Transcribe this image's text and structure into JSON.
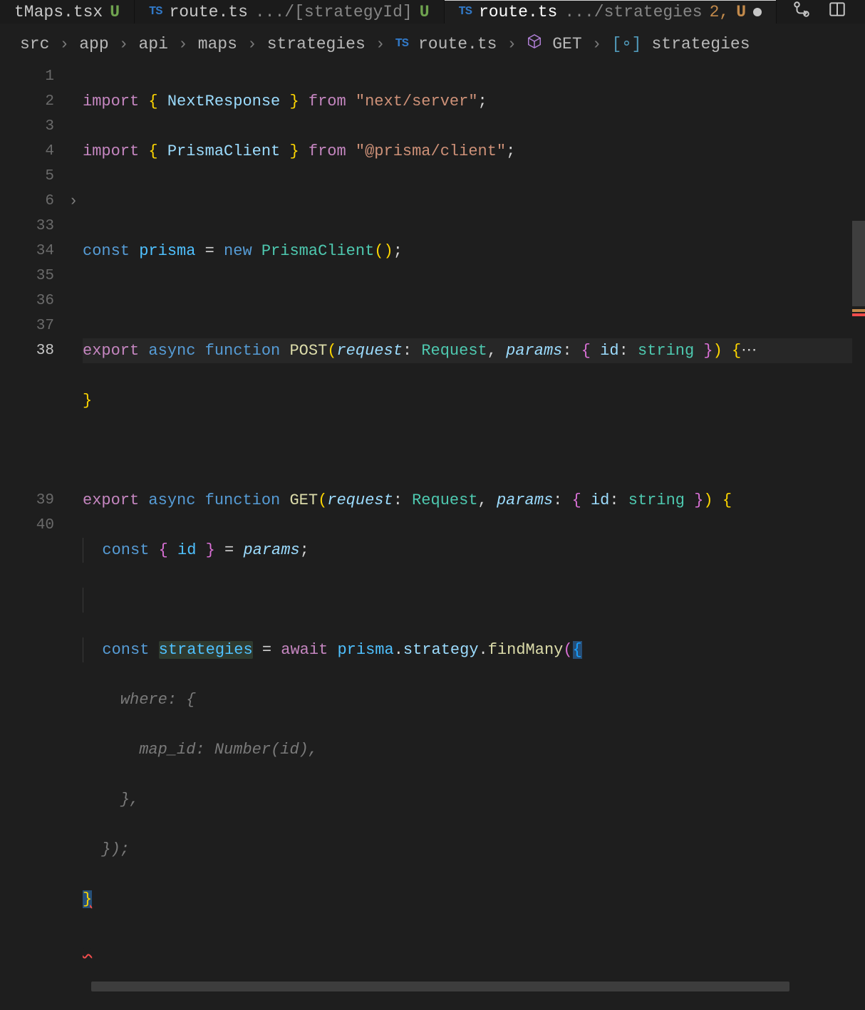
{
  "tabs": [
    {
      "icon": "",
      "name": "tMaps.tsx",
      "path": "",
      "flag": "U",
      "problems": "",
      "dirty": false,
      "active": false,
      "ts": false
    },
    {
      "icon": "TS",
      "name": "route.ts",
      "path": ".../[strategyId]",
      "flag": "U",
      "problems": "",
      "dirty": false,
      "active": false,
      "ts": true
    },
    {
      "icon": "TS",
      "name": "route.ts",
      "path": ".../strategies",
      "flag": "U",
      "problems": "2,",
      "dirty": true,
      "active": true,
      "ts": true
    }
  ],
  "actions": {
    "compare": "compare",
    "split": "split",
    "more": "..."
  },
  "breadcrumb": {
    "segs": [
      "src",
      "app",
      "api",
      "maps",
      "strategies"
    ],
    "file": {
      "icon": "TS",
      "name": "route.ts"
    },
    "sym": {
      "icon": "cube",
      "name": "GET"
    },
    "sym2": {
      "icon": "brackets",
      "name": "strategies"
    }
  },
  "code": {
    "lines": [
      "1",
      "2",
      "3",
      "4",
      "5",
      "6",
      "33",
      "34",
      "35",
      "36",
      "37",
      "38",
      "",
      "",
      "",
      "",
      "",
      "39",
      "40"
    ],
    "current_line_index": 11,
    "tokens": {
      "import": "import",
      "from": "from",
      "nr": "NextResponse",
      "ns": "\"next/server\"",
      "pc": "PrismaClient",
      "pcmod": "\"@prisma/client\"",
      "const": "const",
      "prisma": "prisma",
      "new": "new",
      "export": "export",
      "async": "async",
      "function": "function",
      "POST": "POST",
      "GET": "GET",
      "request": "request",
      "Request": "Request",
      "params": "params",
      "id": "id",
      "string": "string",
      "strategies": "strategies",
      "await": "await",
      "strategy": "strategy",
      "findMany": "findMany",
      "where": "where:",
      "map_id": "map_id:",
      "Number": "Number",
      "idp": "id",
      "brOpen": "{",
      "brClose": "}",
      "ellipsis": "⋯"
    }
  }
}
